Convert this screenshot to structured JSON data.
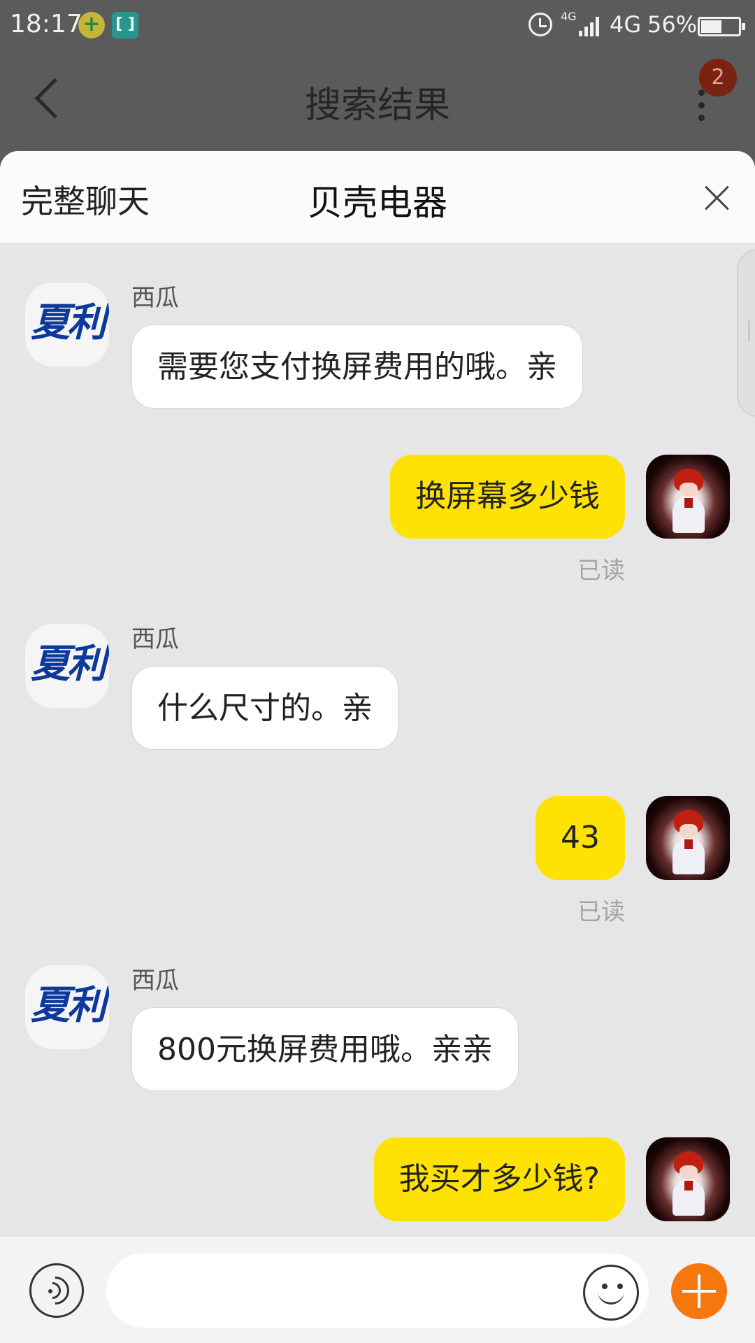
{
  "status_bar": {
    "time": "18:17",
    "network_small": "4G",
    "network": "4G",
    "battery_percent": "56%",
    "battery_level": 0.56
  },
  "underlying_header": {
    "title": "搜索结果",
    "notification_count": "2"
  },
  "chat": {
    "full_chat_label": "完整聊天",
    "title": "贝壳电器",
    "shop_logo_text": "夏利",
    "messages": [
      {
        "side": "in",
        "sender": "西瓜",
        "text": "需要您支付换屏费用的哦。亲"
      },
      {
        "side": "out",
        "text": "换屏幕多少钱",
        "status": "已读"
      },
      {
        "side": "in",
        "sender": "西瓜",
        "text": "什么尺寸的。亲"
      },
      {
        "side": "out",
        "text": "43",
        "status": "已读"
      },
      {
        "side": "in",
        "sender": "西瓜",
        "text": "800元换屏费用哦。亲亲"
      },
      {
        "side": "out",
        "text": "我买才多少钱?",
        "status": ""
      }
    ]
  },
  "input_bar": {
    "placeholder": "",
    "accent_color": "#f7770f"
  },
  "colors": {
    "outgoing_bubble": "#fde203",
    "incoming_bubble": "#ffffff",
    "chat_background": "#e6e6e6"
  }
}
